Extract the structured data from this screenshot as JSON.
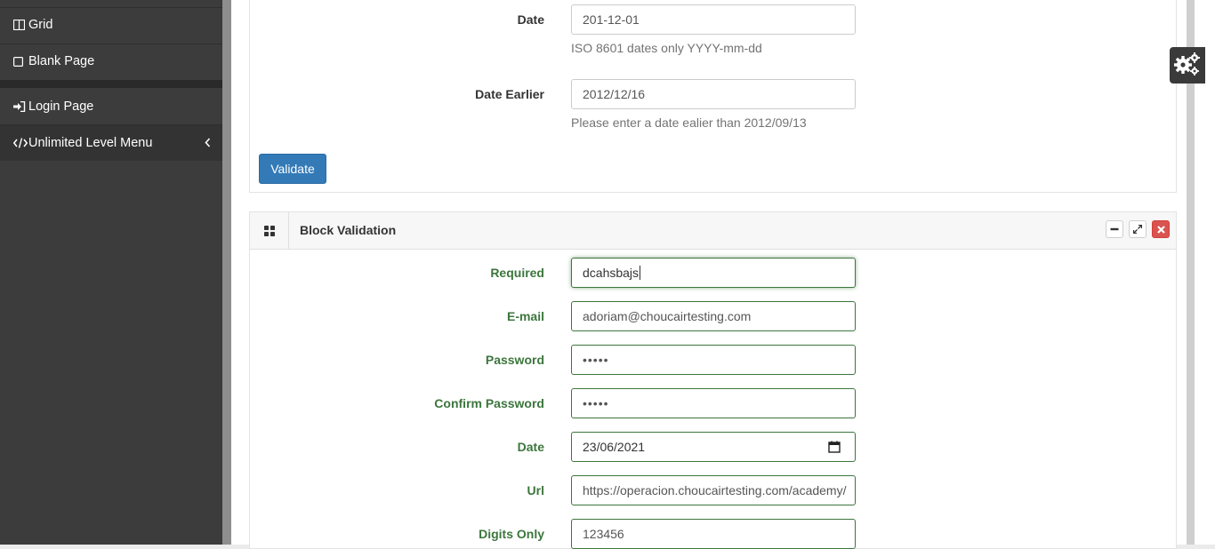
{
  "sidebar": {
    "items": [
      {
        "label": "Grid",
        "icon": "grid-icon"
      },
      {
        "label": "Blank Page",
        "icon": "square-icon"
      },
      {
        "label": "Login Page",
        "icon": "sign-in-icon"
      },
      {
        "label": "Unlimited Level Menu",
        "icon": "code-icon"
      }
    ]
  },
  "top_form": {
    "date": {
      "label": "Date",
      "value": "201-12-01",
      "help": "ISO 8601 dates only YYYY-mm-dd"
    },
    "date_earlier": {
      "label": "Date Earlier",
      "value": "2012/12/16",
      "help": "Please enter a date ealier than 2012/09/13"
    },
    "validate_label": "Validate"
  },
  "block_validation": {
    "title": "Block Validation",
    "fields": {
      "required": {
        "label": "Required",
        "value": "dcahsbajs"
      },
      "email": {
        "label": "E-mail",
        "value": "adoriam@choucairtesting.com"
      },
      "password": {
        "label": "Password",
        "value": "•••••"
      },
      "confirm_password": {
        "label": "Confirm Password",
        "value": "•••••"
      },
      "date": {
        "label": "Date",
        "value": "23/06/2021"
      },
      "url": {
        "label": "Url",
        "value": "https://operacion.choucairtesting.com/academy/"
      },
      "digits": {
        "label": "Digits Only",
        "value": "123456"
      }
    }
  },
  "colors": {
    "sidebar_bg": "#3c3c3c",
    "primary": "#337ab7",
    "success": "#3c763d",
    "danger": "#d9534f"
  }
}
